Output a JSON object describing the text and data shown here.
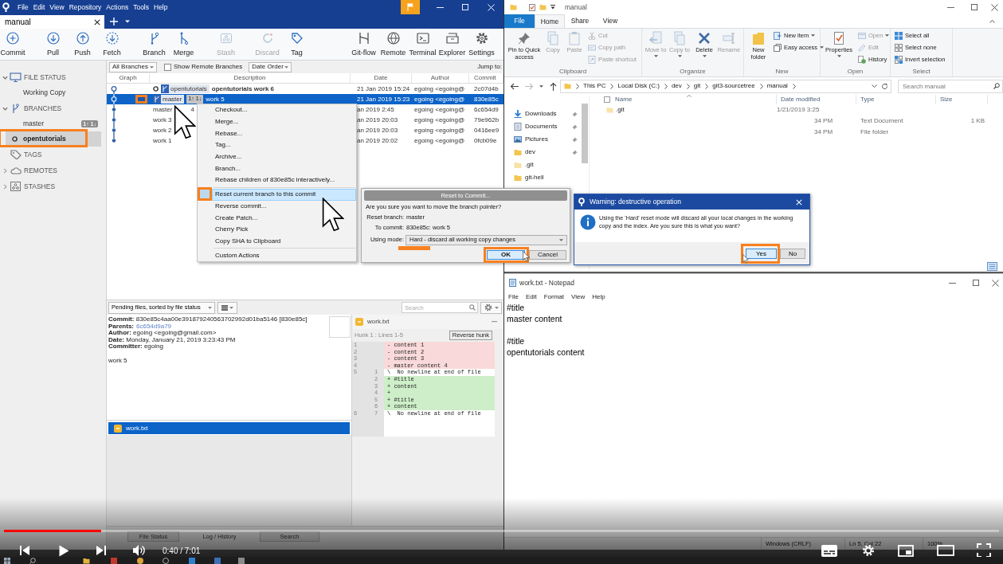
{
  "sourcetree": {
    "menu": [
      "File",
      "Edit",
      "View",
      "Repository",
      "Actions",
      "Tools",
      "Help"
    ],
    "tabs": [
      {
        "label": "manual",
        "selected": true
      }
    ],
    "toolbar": [
      [
        {
          "label": "Commit",
          "disabled": false
        }
      ],
      [
        {
          "label": "Pull",
          "disabled": false
        },
        {
          "label": "Push",
          "disabled": false
        },
        {
          "label": "Fetch",
          "disabled": false
        }
      ],
      [
        {
          "label": "Branch",
          "disabled": false
        },
        {
          "label": "Merge",
          "disabled": false
        }
      ],
      [
        {
          "label": "Stash",
          "disabled": true
        }
      ],
      [
        {
          "label": "Discard",
          "disabled": true
        },
        {
          "label": "Tag",
          "disabled": false
        }
      ],
      [
        {
          "label": "Git-flow",
          "disabled": false
        },
        {
          "label": "Remote",
          "disabled": false
        },
        {
          "label": "Terminal",
          "disabled": false
        },
        {
          "label": "Explorer",
          "disabled": false
        },
        {
          "label": "Settings",
          "disabled": false
        }
      ]
    ],
    "sidebar": [
      {
        "label": "FILE STATUS",
        "expandable": true,
        "expanded": true,
        "children": [
          {
            "label": "Working Copy",
            "selected": false,
            "current": false,
            "highlighted": false
          }
        ]
      },
      {
        "label": "BRANCHES",
        "expandable": true,
        "expanded": true,
        "children": [
          {
            "label": "master",
            "badge": "1↑ 1↓",
            "selected": false,
            "current": false,
            "highlighted": false
          },
          {
            "label": "opentutorials",
            "selected": true,
            "current": true,
            "highlighted": true
          }
        ]
      },
      {
        "label": "TAGS",
        "expandable": false
      },
      {
        "label": "REMOTES",
        "expandable": true,
        "expanded": false
      },
      {
        "label": "STASHES",
        "expandable": true,
        "expanded": false
      }
    ],
    "filters": {
      "branches": "All Branches",
      "remote_branches": {
        "label": "Show Remote Branches",
        "checked": false
      },
      "order": "Date Order",
      "jump": "Jump to:"
    },
    "columns": [
      "Graph",
      "Description",
      "Date",
      "Author",
      "Commit"
    ],
    "commits": [
      {
        "tip": true,
        "head": true,
        "selected": false,
        "highlighted": false,
        "refs": [
          {
            "label": "opentutorials"
          }
        ],
        "description": "opentutorials work 6",
        "date": "21 Jan 2019 15:24",
        "author": "egoing <egoing@",
        "commit": "2c07d4b"
      },
      {
        "tip": true,
        "head": false,
        "selected": true,
        "highlighted": true,
        "refs": [
          {
            "label": "master",
            "badge": "1↑ 1↓"
          }
        ],
        "description": "work 5",
        "date": "21 Jan 2019 15:23",
        "author": "egoing <egoing@",
        "commit": "830e85c"
      },
      {
        "tip": false,
        "head": false,
        "selected": false,
        "highlighted": false,
        "description": "master",
        "description_tail": "4",
        "date": "an 2019 2:45",
        "author": "egoing <egoing@",
        "commit": "6c654d9"
      },
      {
        "tip": false,
        "head": false,
        "selected": false,
        "highlighted": false,
        "description": "work 3",
        "date": "an 2019 20:03",
        "author": "egoing <egoing@",
        "commit": "79e962b"
      },
      {
        "tip": false,
        "head": false,
        "selected": false,
        "highlighted": false,
        "description": "work 2",
        "date": "an 2019 20:03",
        "author": "egoing <egoing@",
        "commit": "0416ee9"
      },
      {
        "tip": false,
        "head": false,
        "selected": false,
        "highlighted": false,
        "description": "work 1",
        "date": "an 2019 20:02",
        "author": "egoing <egoing@",
        "commit": "0fcb09e"
      }
    ],
    "context_menu": [
      {
        "kind": "item",
        "label": "Checkout...",
        "hovered": false,
        "highlighted": false
      },
      {
        "kind": "item",
        "label": "Merge...",
        "hovered": false,
        "highlighted": false
      },
      {
        "kind": "item",
        "label": "Rebase...",
        "hovered": false,
        "highlighted": false
      },
      {
        "kind": "item",
        "label": "Tag...",
        "hovered": false,
        "highlighted": false
      },
      {
        "kind": "item",
        "label": "Archive...",
        "hovered": false,
        "highlighted": false
      },
      {
        "kind": "item",
        "label": "Branch...",
        "hovered": false,
        "highlighted": false
      },
      {
        "kind": "item",
        "label": "Rebase children of 830e85c interactively...",
        "hovered": false,
        "highlighted": false
      },
      {
        "kind": "separator"
      },
      {
        "kind": "item",
        "label": "Reset current branch to this commit",
        "hovered": true,
        "highlighted": true
      },
      {
        "kind": "item",
        "label": "Reverse commit...",
        "hovered": false,
        "highlighted": false
      },
      {
        "kind": "item",
        "label": "Create Patch...",
        "hovered": false,
        "highlighted": false
      },
      {
        "kind": "item",
        "label": "Cherry Pick",
        "hovered": false,
        "highlighted": false
      },
      {
        "kind": "item",
        "label": "Copy SHA to Clipboard",
        "hovered": false,
        "highlighted": false
      },
      {
        "kind": "separator"
      },
      {
        "kind": "item",
        "label": "Custom Actions",
        "hovered": false,
        "highlighted": false
      }
    ],
    "pending": {
      "label": "Pending files, sorted by file status",
      "search_placeholder": "Search"
    },
    "details": {
      "lines": [
        {
          "kind": "text",
          "label": "Commit:",
          "value": "830e85c4aa00e391879240563702992d01ba5146 [830e85c]"
        },
        {
          "kind": "link",
          "label": "Parents:",
          "value": "6c654d9a79"
        },
        {
          "kind": "text",
          "label": "Author:",
          "value": "egoing <egoing@gmail.com>"
        },
        {
          "kind": "text",
          "label": "Date:",
          "value": "Monday, January 21, 2019 3:23:43 PM"
        },
        {
          "kind": "text",
          "label": "Committer:",
          "value": "egoing"
        }
      ],
      "message": "work 5"
    },
    "files": [
      {
        "name": "work.txt",
        "selected": true
      }
    ],
    "diff": {
      "file": "work.txt",
      "hunk": "Hunk 1 : Lines 1-5",
      "reverse": "Reverse hunk",
      "lines": [
        {
          "kind": "removed",
          "old": "1",
          "text": "- content 1"
        },
        {
          "kind": "removed",
          "old": "2",
          "text": "- content 2"
        },
        {
          "kind": "removed",
          "old": "3",
          "text": "- content 3"
        },
        {
          "kind": "removed",
          "old": "4",
          "text": "- master content 4"
        },
        {
          "kind": "context",
          "old": "5",
          "new": "1",
          "text": "\\  No newline at end of file"
        },
        {
          "kind": "added",
          "new": "2",
          "text": "+ #title"
        },
        {
          "kind": "added",
          "new": "3",
          "text": "+ content"
        },
        {
          "kind": "added",
          "new": "4",
          "text": "+"
        },
        {
          "kind": "added",
          "new": "5",
          "text": "+ #title"
        },
        {
          "kind": "added",
          "new": "6",
          "text": "+ content"
        },
        {
          "kind": "context",
          "old": "6",
          "new": "7",
          "text": "\\  No newline at end of file"
        }
      ]
    },
    "bottom_tabs": [
      {
        "label": "File Status",
        "selected": false
      },
      {
        "label": "Log / History",
        "selected": true
      },
      {
        "label": "Search",
        "selected": false
      }
    ]
  },
  "reset_dialog": {
    "title": "Reset to Commit...",
    "question": "Are you sure you want to move the branch pointer?",
    "fields": [
      {
        "label": "Reset branch:",
        "value": "master"
      },
      {
        "label": "To commit:",
        "value": "830e85c: work 5"
      }
    ],
    "mode": {
      "label": "Using mode:",
      "value": "Hard - discard all working copy changes",
      "highlighted": true
    },
    "buttons": [
      {
        "label": "OK",
        "default": true,
        "highlighted": true
      },
      {
        "label": "Cancel",
        "default": false,
        "highlighted": false
      }
    ]
  },
  "warning_dialog": {
    "title": "Warning: destructive operation",
    "message": "Using the 'Hard' reset mode will discard all your local changes in the working copy and the index. Are you sure this is what you want?",
    "buttons": [
      {
        "label": "Yes",
        "default": true,
        "highlighted": true
      },
      {
        "label": "No",
        "default": false,
        "highlighted": false
      }
    ]
  },
  "explorer": {
    "title": "manual",
    "tabs": [
      {
        "label": "File",
        "kind": "menu",
        "selected": false
      },
      {
        "label": "Home",
        "kind": "tab",
        "selected": true
      },
      {
        "label": "Share",
        "kind": "tab",
        "selected": false
      },
      {
        "label": "View",
        "kind": "tab",
        "selected": false
      }
    ],
    "ribbon": [
      {
        "label": "Clipboard",
        "large": [
          {
            "label": "Pin to Quick access",
            "disabled": false,
            "menu": false
          },
          {
            "label": "Copy",
            "disabled": true,
            "menu": false
          },
          {
            "label": "Paste",
            "disabled": true,
            "menu": false
          }
        ],
        "small": [
          {
            "label": "Cut",
            "disabled": true,
            "menu": false
          },
          {
            "label": "Copy path",
            "disabled": true,
            "menu": false
          },
          {
            "label": "Paste shortcut",
            "disabled": true,
            "menu": false
          }
        ]
      },
      {
        "label": "Organize",
        "large": [
          {
            "label": "Move to",
            "disabled": true,
            "menu": true
          },
          {
            "label": "Copy to",
            "disabled": true,
            "menu": true
          },
          {
            "label": "Delete",
            "disabled": false,
            "menu": true
          },
          {
            "label": "Rename",
            "disabled": true,
            "menu": false
          }
        ]
      },
      {
        "label": "New",
        "large": [
          {
            "label": "New folder",
            "disabled": false,
            "menu": false
          }
        ],
        "small": [
          {
            "label": "New item",
            "disabled": false,
            "menu": true
          },
          {
            "label": "Easy access",
            "disabled": false,
            "menu": true
          }
        ]
      },
      {
        "label": "Open",
        "large": [
          {
            "label": "Properties",
            "disabled": false,
            "menu": true
          }
        ],
        "small": [
          {
            "label": "Open",
            "disabled": true,
            "menu": true
          },
          {
            "label": "Edit",
            "disabled": true,
            "menu": false
          },
          {
            "label": "History",
            "disabled": false,
            "menu": false
          }
        ]
      },
      {
        "label": "Select",
        "small": [
          {
            "label": "Select all",
            "disabled": false,
            "menu": false
          },
          {
            "label": "Select none",
            "disabled": false,
            "menu": false
          },
          {
            "label": "Invert selection",
            "disabled": false,
            "menu": false
          }
        ]
      }
    ],
    "path": [
      "This PC",
      "Local Disk (C:)",
      "dev",
      "git",
      "git3-sourcetree",
      "manual"
    ],
    "search_placeholder": "Search manual",
    "nav": [
      {
        "label": "Downloads",
        "pinned": true
      },
      {
        "label": "Documents",
        "pinned": true
      },
      {
        "label": "Pictures",
        "pinned": true
      },
      {
        "label": "dev",
        "pinned": true
      },
      {
        "label": ".git",
        "pinned": false
      },
      {
        "label": "git-hell",
        "pinned": false
      }
    ],
    "select_all": {
      "checked": false
    },
    "columns": [
      "Name",
      "Date modified",
      "Type",
      "Size"
    ],
    "files": [
      {
        "kind": "folder",
        "name": ".git",
        "date": "1/21/2019 3:25"
      },
      {
        "kind": "partial",
        "date": "34 PM",
        "type": "Text Document",
        "size": "1 KB"
      },
      {
        "kind": "partial",
        "date": "34 PM",
        "type": "File folder"
      }
    ]
  },
  "notepad": {
    "title": "work.txt - Notepad",
    "menu": [
      "File",
      "Edit",
      "Format",
      "View",
      "Help"
    ],
    "text": "#title\nmaster content\n\n#title\nopentutorials content",
    "status": [
      "Windows (CRLF)",
      "Ln 5, Col 22",
      "100%"
    ]
  },
  "player": {
    "progress": {
      "level": 0.098
    },
    "time": "0:40 / 7:01"
  }
}
